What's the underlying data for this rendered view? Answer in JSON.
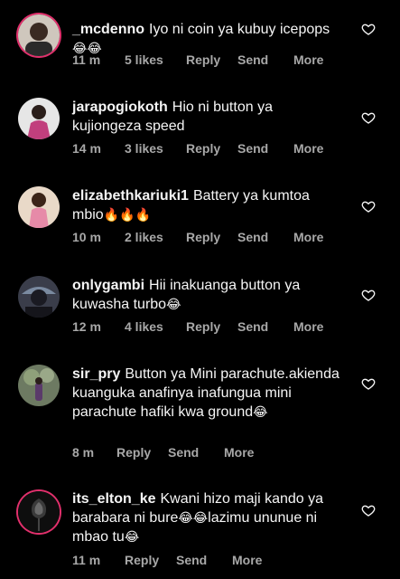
{
  "actions": {
    "reply": "Reply",
    "send": "Send",
    "more": "More"
  },
  "comments": [
    {
      "username": "_mcdenno",
      "text": "Iyo ni coin ya kubuy icepops",
      "emoji": "😂😂",
      "time": "11 m",
      "likes": "5 likes",
      "avatar_colors": [
        "#8b6a4f",
        "#2a1d16"
      ],
      "icon": "heart-icon"
    },
    {
      "username": "jarapogiokoth",
      "text": "Hio ni button ya kujiongeza speed",
      "emoji": "",
      "time": "14 m",
      "likes": "3 likes",
      "avatar_colors": [
        "#d8d8d8",
        "#c0407c"
      ],
      "icon": "heart-icon"
    },
    {
      "username": "elizabethkariuki1",
      "text": "Battery ya kumtoa mbio",
      "emoji": "🔥🔥🔥",
      "time": "10 m",
      "likes": "2 likes",
      "avatar_colors": [
        "#e8d6c4",
        "#e58aa6"
      ],
      "icon": "heart-icon"
    },
    {
      "username": "onlygambi",
      "text": "Hii inakuanga button ya kuwasha turbo",
      "emoji": "😂",
      "time": "12 m",
      "likes": "4 likes",
      "avatar_colors": [
        "#5a5a6a",
        "#1c1c24"
      ],
      "icon": "heart-icon"
    },
    {
      "username": "sir_pry",
      "text": "Button ya Mini parachute.akienda kuanguka anafinya inafungua mini parachute hafiki kwa ground",
      "emoji": "😂",
      "time": "8 m",
      "likes": "",
      "avatar_colors": [
        "#7a8a6a",
        "#4a3b5a"
      ],
      "icon": "heart-icon"
    },
    {
      "username": "its_elton_ke",
      "text": "Kwani hizo maji kando ya barabara ni bure",
      "text2": "lazimu ununue ni mbao tu",
      "emoji": "😂😂",
      "emoji2": "😂",
      "time": "11 m",
      "likes": "",
      "avatar_colors": [
        "#1a1a1a",
        "#555555"
      ],
      "icon": "heart-icon"
    }
  ]
}
